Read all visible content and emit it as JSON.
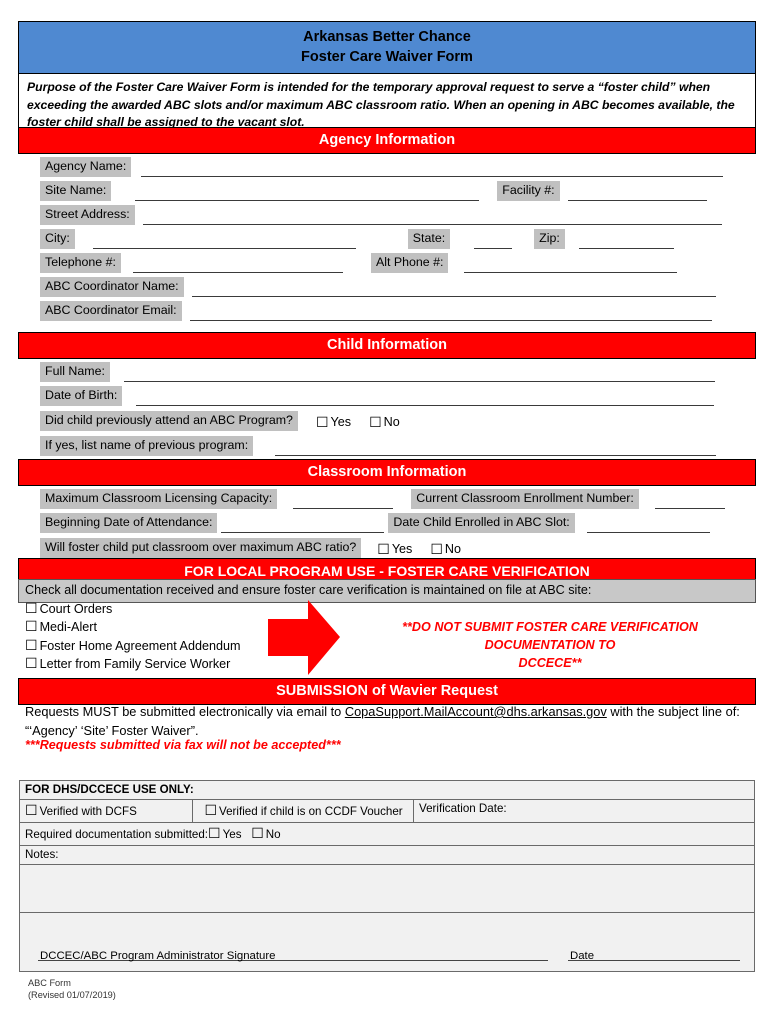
{
  "header": {
    "title_line1": "Arkansas Better Chance",
    "title_line2": "Foster Care Waiver Form",
    "banner_color": "#4F89D1",
    "purpose": "Purpose of the Foster Care Waiver Form is intended for the temporary approval request to serve a “foster child” when exceeding the awarded ABC slots and/or maximum ABC classroom ratio. When an opening in ABC becomes available, the foster child shall be assigned to the vacant slot."
  },
  "colors": {
    "section_red": "#FF0000",
    "label_gray": "#C0C0C0",
    "table_gray": "#F1F1F1",
    "banner_blue": "#4F89D1"
  },
  "sections": {
    "agency": "Agency Information",
    "child": "Child Information",
    "classroom": "Classroom Information",
    "local_use": "FOR LOCAL PROGRAM USE - FOSTER CARE VERIFICATION",
    "submission": "SUBMISSION of Wavier Request"
  },
  "agency": {
    "agency_name": "Agency Name:",
    "site_name": "Site Name:",
    "facility_no": "Facility #:",
    "street_address": "Street Address:",
    "city": "City:",
    "state": "State:",
    "zip": "Zip:",
    "telephone": "Telephone #:",
    "alt_phone": "Alt Phone #:",
    "coordinator_name": "ABC Coordinator Name:",
    "coordinator_email": "ABC Coordinator Email:"
  },
  "child": {
    "full_name": "Full Name:",
    "dob": "Date of Birth:",
    "prev_attend_question": "Did child previously attend an ABC Program?",
    "yes": "Yes",
    "no": "No",
    "prev_program": "If yes, list name of previous program:"
  },
  "classroom": {
    "max_capacity": "Maximum Classroom Licensing Capacity:",
    "current_enrollment": "Current Classroom Enrollment Number:",
    "begin_date": "Beginning Date of Attendance:",
    "date_enrolled": "Date Child Enrolled in ABC Slot:",
    "ratio_question": "Will foster child put classroom over maximum ABC ratio?",
    "yes": "Yes",
    "no": "No"
  },
  "local_use": {
    "instruction": "Check all documentation received and ensure foster care verification is maintained on file at ABC site:",
    "documents": [
      "Court Orders",
      "Medi-Alert",
      "Foster Home Agreement Addendum",
      "Letter from Family Service Worker"
    ],
    "warning_line1": "**DO NOT SUBMIT FOSTER CARE VERIFICATION DOCUMENTATION TO",
    "warning_line2": "DCCECE**"
  },
  "submission": {
    "text_before_email": "Requests MUST be submitted electronically via email to ",
    "email": "CopaSupport.MailAccount@dhs.arkansas.gov",
    "text_after_email": " with the subject line of: “‘Agency’ ‘Site’ Foster Waiver”.",
    "fax_note": "***Requests submitted via fax will not be accepted***"
  },
  "dhs_table": {
    "header": "FOR DHS/DCCECE USE ONLY:",
    "verified_dcfs": "Verified with DCFS",
    "verified_ccdf": "Verified if child is on CCDF Voucher",
    "verification_date": "Verification Date:",
    "required_docs": "Required documentation submitted:",
    "yes": "Yes",
    "no": "No",
    "notes": "Notes:",
    "signature_caption": "DCCEC/ABC Program Administrator Signature",
    "date_caption": "Date"
  },
  "footer": {
    "line1": "ABC Form",
    "line2": "(Revised 01/07/2019)"
  },
  "icons": {
    "checkbox": "☐",
    "arrow": "right-arrow"
  }
}
